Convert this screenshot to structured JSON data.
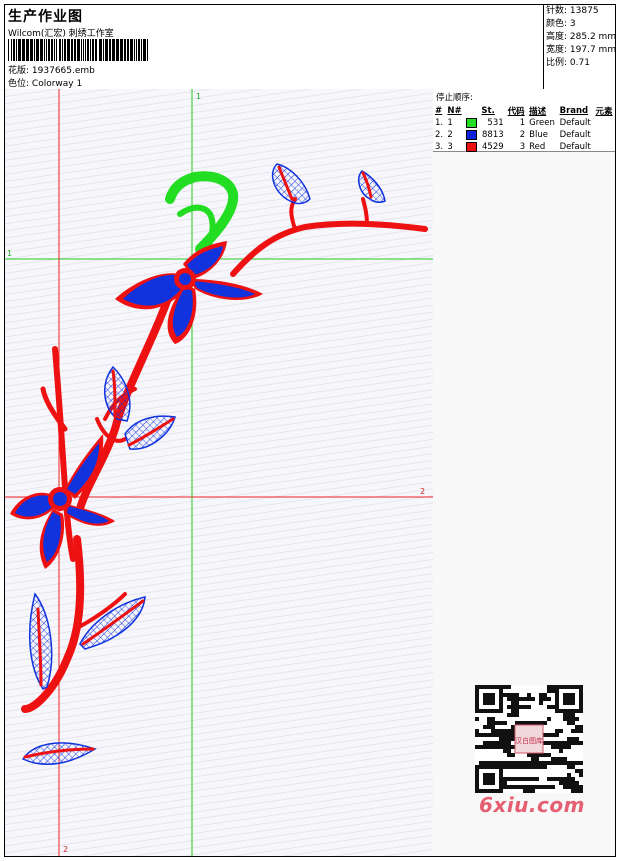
{
  "header": {
    "title": "生产作业图",
    "company": "Wilcom(汇宏) 刺绣工作室",
    "design_label": "花版:",
    "design_file": "1937665.emb",
    "colorway_label": "色位:",
    "colorway": "Colorway 1"
  },
  "stats": [
    {
      "label": "针数:",
      "value": "13875"
    },
    {
      "label": "颜色:",
      "value": "3"
    },
    {
      "label": "高度:",
      "value": "285.2 mm"
    },
    {
      "label": "宽度:",
      "value": "197.7 mm"
    },
    {
      "label": "比例:",
      "value": "0.71"
    }
  ],
  "stop_sequence": {
    "title": "停止顺序:",
    "columns": [
      "#",
      "N#",
      "St.",
      "代码",
      "描述",
      "Brand",
      "元素"
    ],
    "rows": [
      {
        "index": "1.",
        "n": "1",
        "color": "#22dd22",
        "st": "531",
        "code": "1",
        "desc": "Green",
        "brand": "Default"
      },
      {
        "index": "2.",
        "n": "2",
        "color": "#1122dd",
        "st": "8813",
        "code": "2",
        "desc": "Blue",
        "brand": "Default"
      },
      {
        "index": "3.",
        "n": "3",
        "color": "#ee1111",
        "st": "4529",
        "code": "3",
        "desc": "Red",
        "brand": "Default"
      }
    ]
  },
  "guides": {
    "v1": "1",
    "h1": "1",
    "h2": "2",
    "v2": "2"
  },
  "watermark": {
    "qr_text": "汉白图库",
    "brand": "6xiu.com"
  },
  "colors": {
    "green": "#22dd22",
    "blue": "#1133dd",
    "red": "#ee1111",
    "guide_green": "#22cc22",
    "guide_red": "#ee2222"
  }
}
